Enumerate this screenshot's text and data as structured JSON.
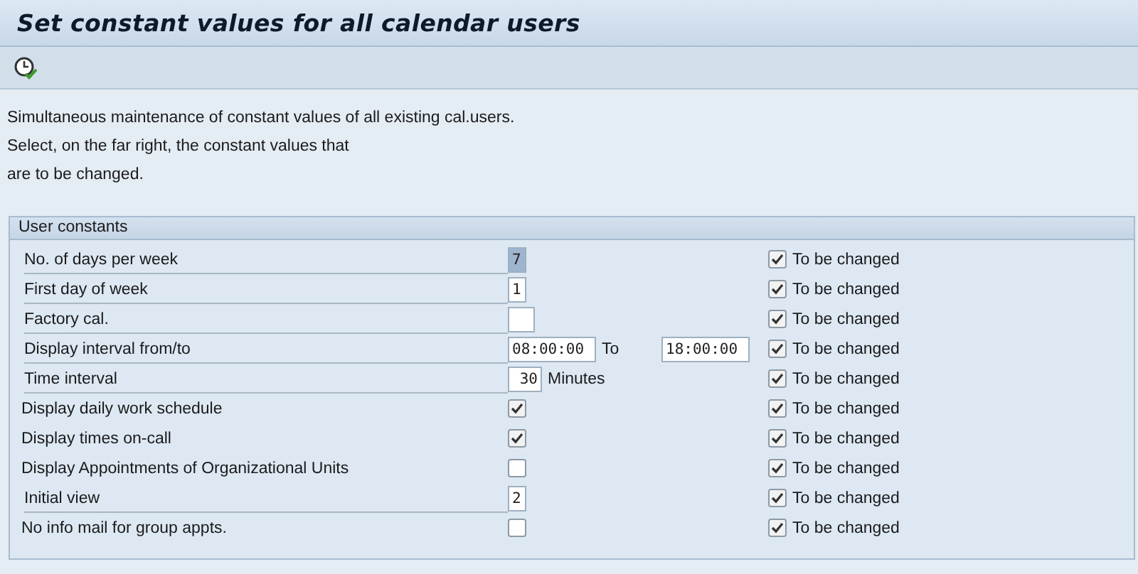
{
  "title": "Set constant values for all calendar users",
  "description": [
    "Simultaneous maintenance of constant values of all existing cal.users.",
    "Select, on the far right, the constant values that",
    "are to be changed."
  ],
  "group": {
    "title": "User constants",
    "rows": [
      {
        "kind": "field",
        "label": "No. of days per week",
        "value": "7",
        "focused": true,
        "change_label": "To be changed",
        "change_checked": true
      },
      {
        "kind": "field",
        "label": "First day of week",
        "value": "1",
        "focused": false,
        "change_label": "To be changed",
        "change_checked": true
      },
      {
        "kind": "field",
        "label": "Factory cal.",
        "value": "",
        "focused": false,
        "change_label": "To be changed",
        "change_checked": true
      },
      {
        "kind": "range",
        "label": "Display interval from/to",
        "from": "08:00:00",
        "to_label": "To",
        "to": "18:00:00",
        "change_label": "To be changed",
        "change_checked": true
      },
      {
        "kind": "unit",
        "label": "Time interval",
        "value": "30",
        "unit": "Minutes",
        "change_label": "To be changed",
        "change_checked": true
      },
      {
        "kind": "checkbox",
        "label": "Display daily work schedule",
        "checked": true,
        "change_label": "To be changed",
        "change_checked": true
      },
      {
        "kind": "checkbox",
        "label": "Display times on-call",
        "checked": true,
        "change_label": "To be changed",
        "change_checked": true
      },
      {
        "kind": "checkbox",
        "label": "Display Appointments of Organizational Units",
        "checked": false,
        "change_label": "To be changed",
        "change_checked": true
      },
      {
        "kind": "field",
        "label": "Initial view",
        "value": "2",
        "focused": false,
        "change_label": "To be changed",
        "change_checked": true
      },
      {
        "kind": "checkbox",
        "label": "No info mail for group appts.",
        "checked": false,
        "change_label": "To be changed",
        "change_checked": true
      }
    ]
  }
}
